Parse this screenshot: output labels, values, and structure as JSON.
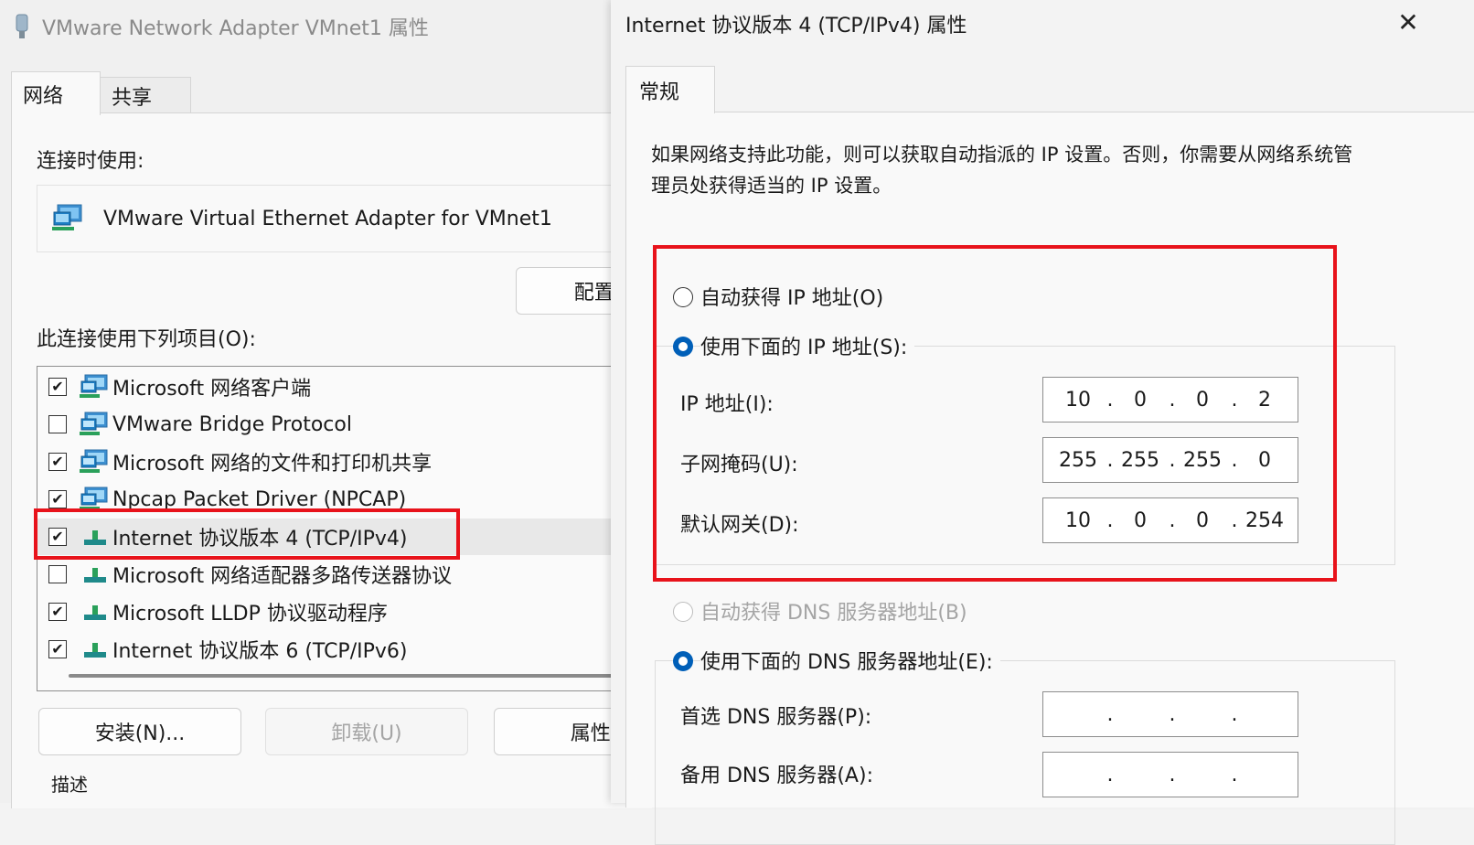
{
  "back_dialog": {
    "title": "VMware Network Adapter VMnet1 属性",
    "tabs": [
      {
        "label": "网络"
      },
      {
        "label": "共享"
      }
    ],
    "connect_using_label": "连接时使用:",
    "adapter_name": "VMware Virtual Ethernet Adapter for VMnet1",
    "configure_button": "配置(",
    "items_label": "此连接使用下列项目(O):",
    "items": [
      {
        "label": "Microsoft 网络客户端",
        "checked": true,
        "icon": "network-client-icon"
      },
      {
        "label": "VMware Bridge Protocol",
        "checked": false,
        "icon": "network-client-icon"
      },
      {
        "label": "Microsoft 网络的文件和打印机共享",
        "checked": true,
        "icon": "network-client-icon"
      },
      {
        "label": "Npcap Packet Driver (NPCAP)",
        "checked": true,
        "icon": "network-client-icon"
      },
      {
        "label": "Internet 协议版本 4 (TCP/IPv4)",
        "checked": true,
        "icon": "protocol-icon"
      },
      {
        "label": "Microsoft 网络适配器多路传送器协议",
        "checked": false,
        "icon": "protocol-icon"
      },
      {
        "label": "Microsoft LLDP 协议驱动程序",
        "checked": true,
        "icon": "protocol-icon"
      },
      {
        "label": "Internet 协议版本 6 (TCP/IPv6)",
        "checked": true,
        "icon": "protocol-icon"
      }
    ],
    "install_button": "安装(N)...",
    "uninstall_button": "卸载(U)",
    "properties_button": "属性(",
    "description_label": "描述"
  },
  "front_dialog": {
    "title": "Internet 协议版本 4 (TCP/IPv4) 属性",
    "close_glyph": "✕",
    "tab": "常规",
    "description": "如果网络支持此功能，则可以获取自动指派的 IP 设置。否则，你需要从网络系统管理员处获得适当的 IP 设置。",
    "radio_auto_ip": "自动获得 IP 地址(O)",
    "radio_manual_ip": "使用下面的 IP 地址(S):",
    "ip_label": "IP 地址(I):",
    "ip_octets": [
      "10",
      "0",
      "0",
      "2"
    ],
    "subnet_label": "子网掩码(U):",
    "subnet_octets": [
      "255",
      "255",
      "255",
      "0"
    ],
    "gateway_label": "默认网关(D):",
    "gateway_octets": [
      "10",
      "0",
      "0",
      "254"
    ],
    "radio_auto_dns": "自动获得 DNS 服务器地址(B)",
    "radio_manual_dns": "使用下面的 DNS 服务器地址(E):",
    "preferred_dns_label": "首选 DNS 服务器(P):",
    "preferred_dns_octets": [
      "",
      "",
      "",
      ""
    ],
    "alternate_dns_label": "备用 DNS 服务器(A):",
    "alternate_dns_octets": [
      "",
      "",
      "",
      ""
    ],
    "ip_mode": "manual",
    "dns_mode": "manual"
  },
  "colors": {
    "highlight_red": "#e8131b",
    "radio_blue": "#005fb8"
  }
}
